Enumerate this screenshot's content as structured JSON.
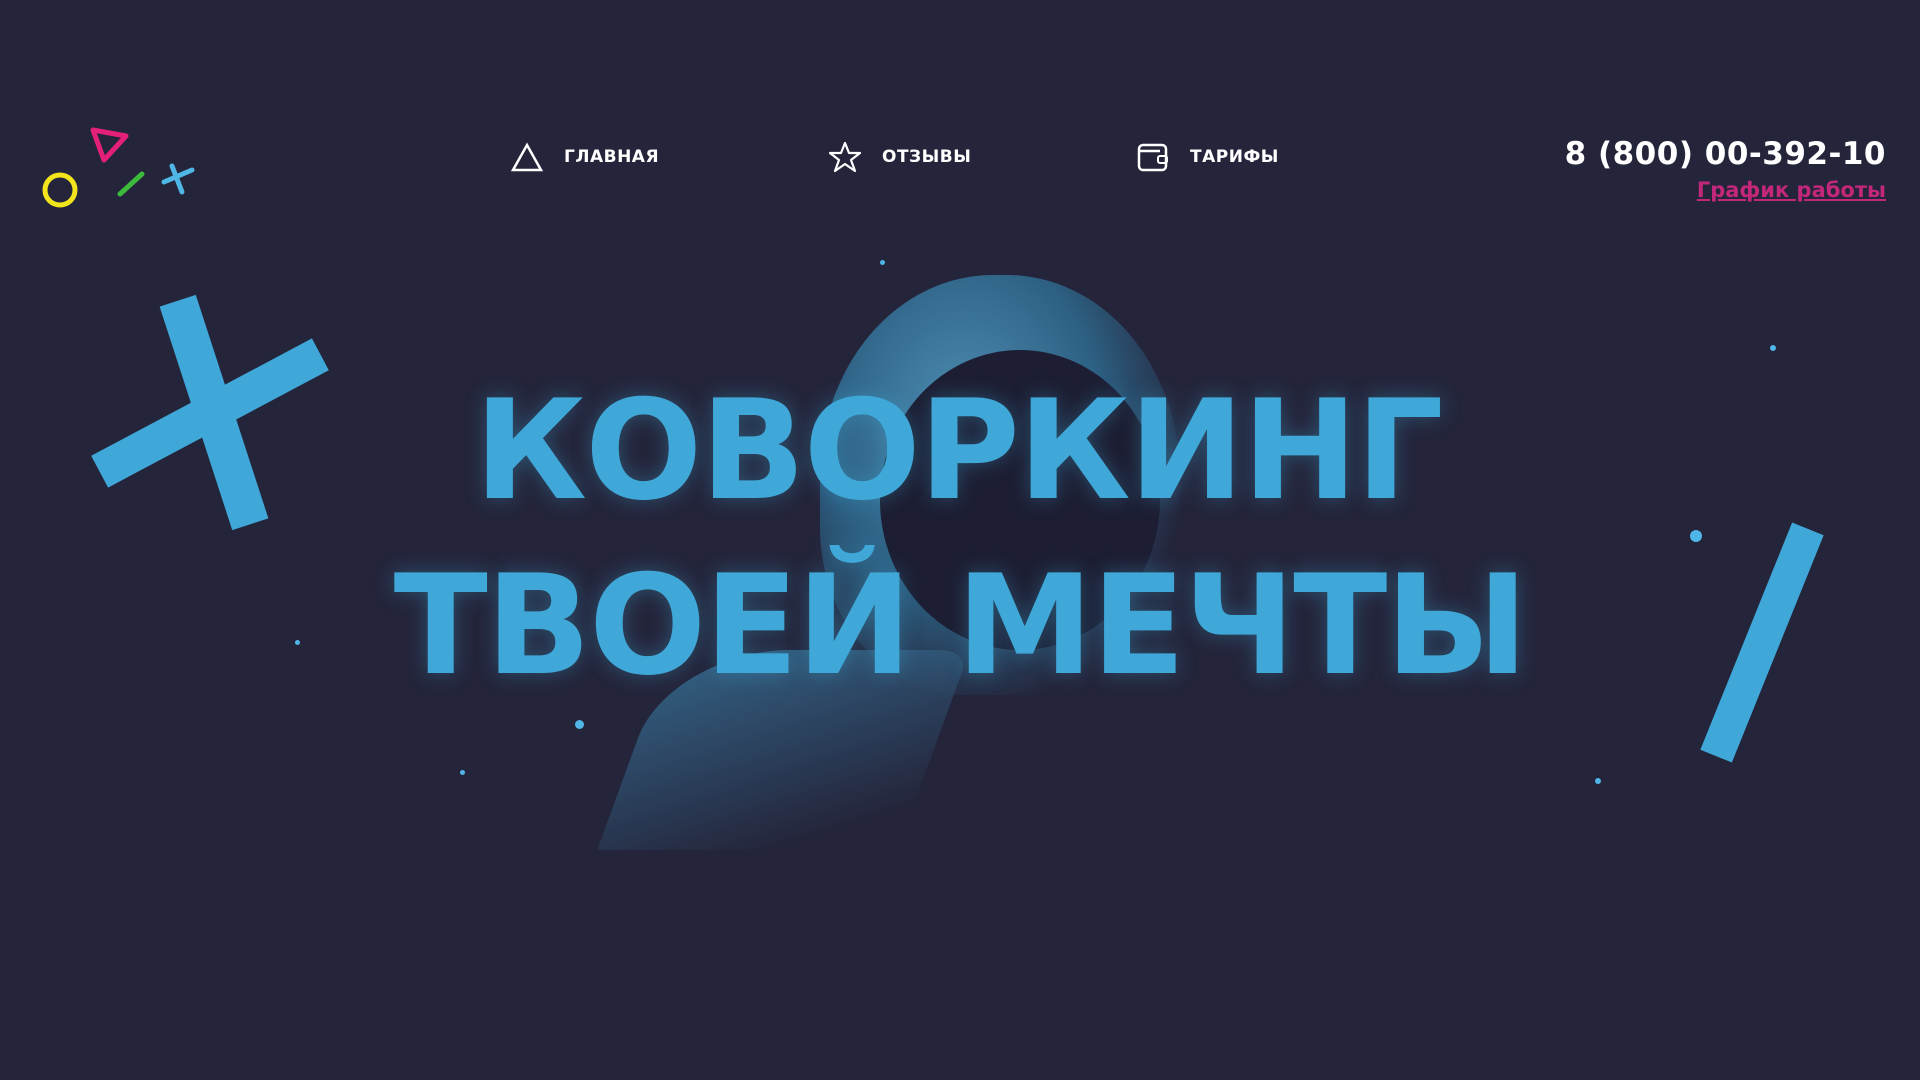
{
  "nav": {
    "items": [
      {
        "label": "ГЛАВНАЯ",
        "icon": "triangle-icon"
      },
      {
        "label": "ОТЗЫВЫ",
        "icon": "star-icon"
      },
      {
        "label": "ТАРИФЫ",
        "icon": "wallet-icon"
      }
    ]
  },
  "contact": {
    "phone": "8 (800) 00-392-10",
    "schedule_link": "График работы"
  },
  "hero": {
    "line1": "КОВОРКИНГ",
    "line2": "ТВОЕЙ МЕЧТЫ"
  },
  "colors": {
    "background": "#24253b",
    "accent_blue": "#3fa8d8",
    "accent_pink": "#c2277a",
    "yellow": "#f2e51c",
    "green": "#3cba3c"
  }
}
